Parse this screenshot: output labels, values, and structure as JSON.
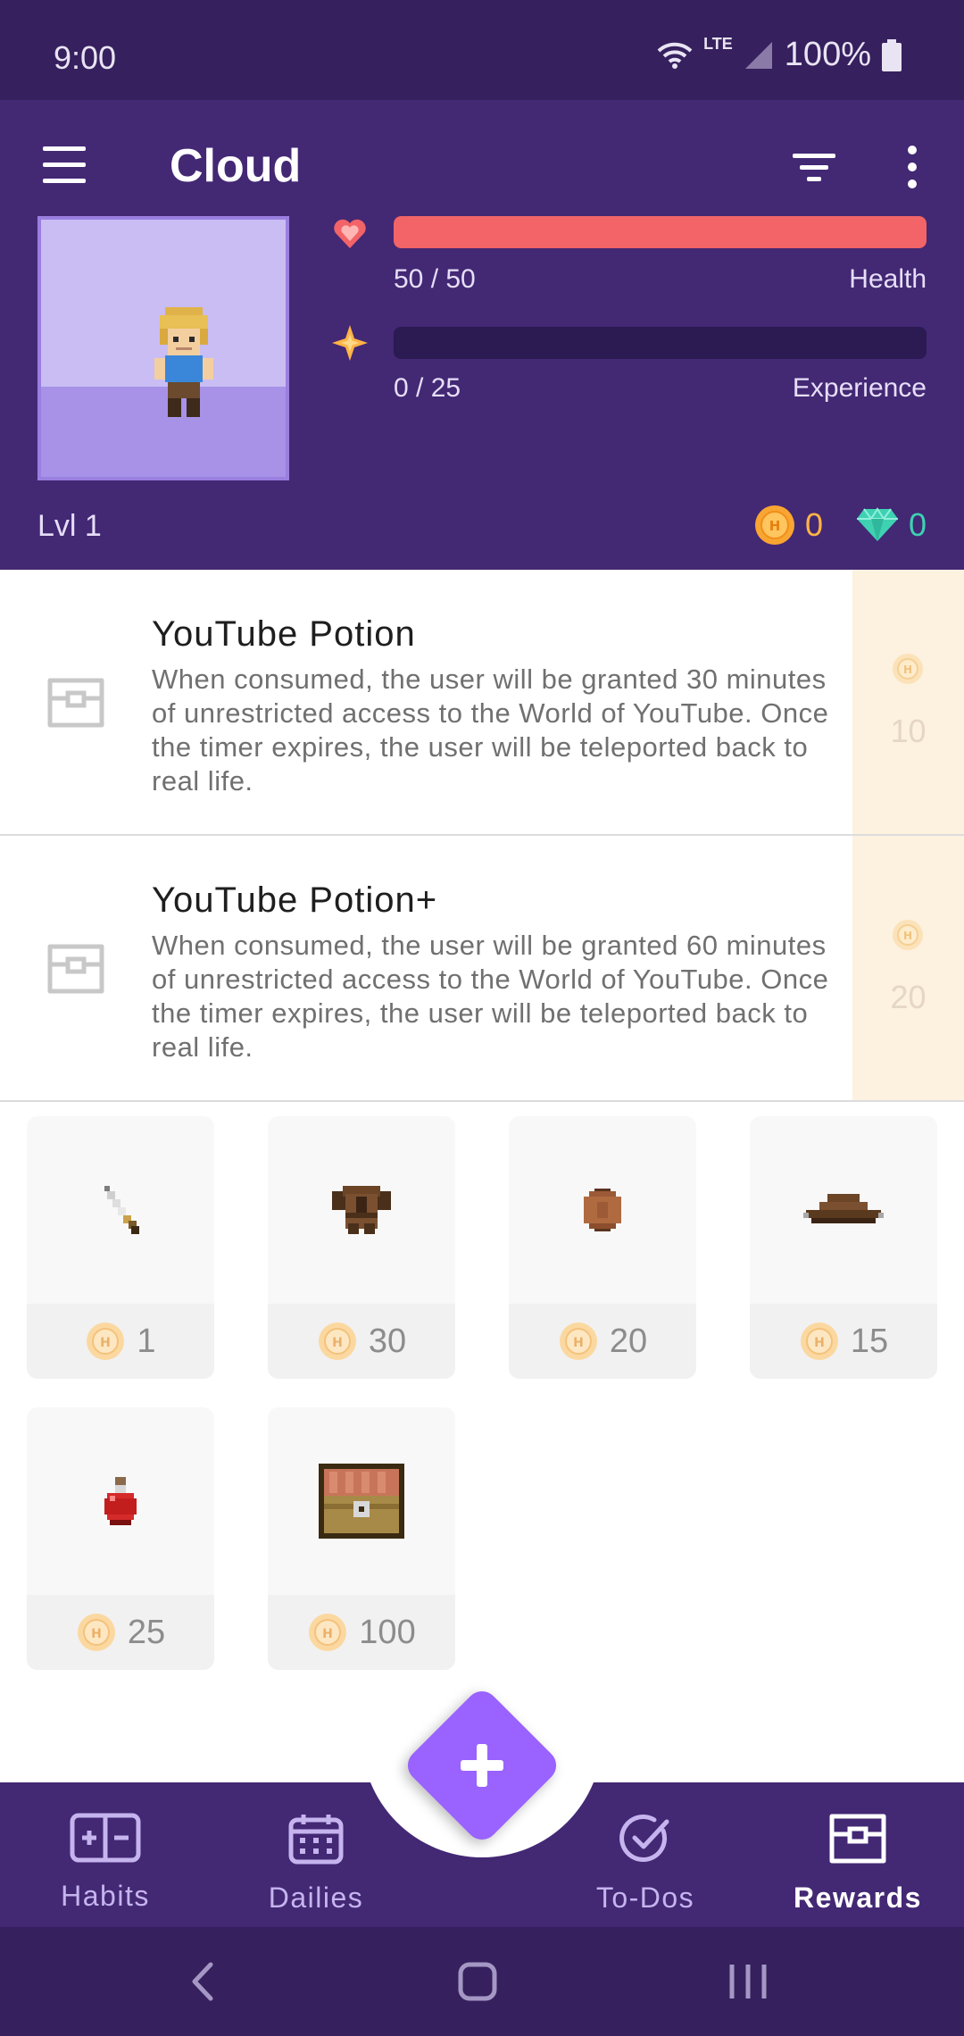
{
  "status_bar": {
    "time": "9:00",
    "network": "LTE",
    "battery": "100%"
  },
  "header": {
    "title": "Cloud",
    "health": {
      "value": "50 / 50",
      "label": "Health",
      "fraction": 1.0
    },
    "experience": {
      "value": "0 / 25",
      "label": "Experience",
      "fraction": 0.0
    },
    "level": "Lvl 1",
    "gold": "0",
    "gems": "0"
  },
  "rewards": [
    {
      "title": "YouTube Potion",
      "description": "When consumed, the user will be granted 30 minutes of unrestricted access to the World of YouTube. Once the timer expires, the user will be teleported back to real life.",
      "price": "10"
    },
    {
      "title": "YouTube Potion+",
      "description": "When consumed, the user will be granted 60 minutes of unrestricted access to the World of YouTube. Once the timer expires, the user will be teleported back to real life.",
      "price": "20"
    }
  ],
  "market_items": [
    {
      "icon": "sword-icon",
      "price": "1"
    },
    {
      "icon": "leather-armor-icon",
      "price": "30"
    },
    {
      "icon": "wooden-shield-icon",
      "price": "20"
    },
    {
      "icon": "leather-helm-icon",
      "price": "15"
    },
    {
      "icon": "health-potion-icon",
      "price": "25"
    },
    {
      "icon": "treasure-chest-icon",
      "price": "100"
    }
  ],
  "nav": {
    "habits": "Habits",
    "dailies": "Dailies",
    "todos": "To-Dos",
    "rewards": "Rewards",
    "active": "rewards"
  },
  "colors": {
    "header_bg": "#432874",
    "status_bg": "#36205e",
    "health": "#f26467",
    "gold": "#ffb445",
    "gem": "#3ed1b2",
    "fab": "#9a62ff"
  }
}
